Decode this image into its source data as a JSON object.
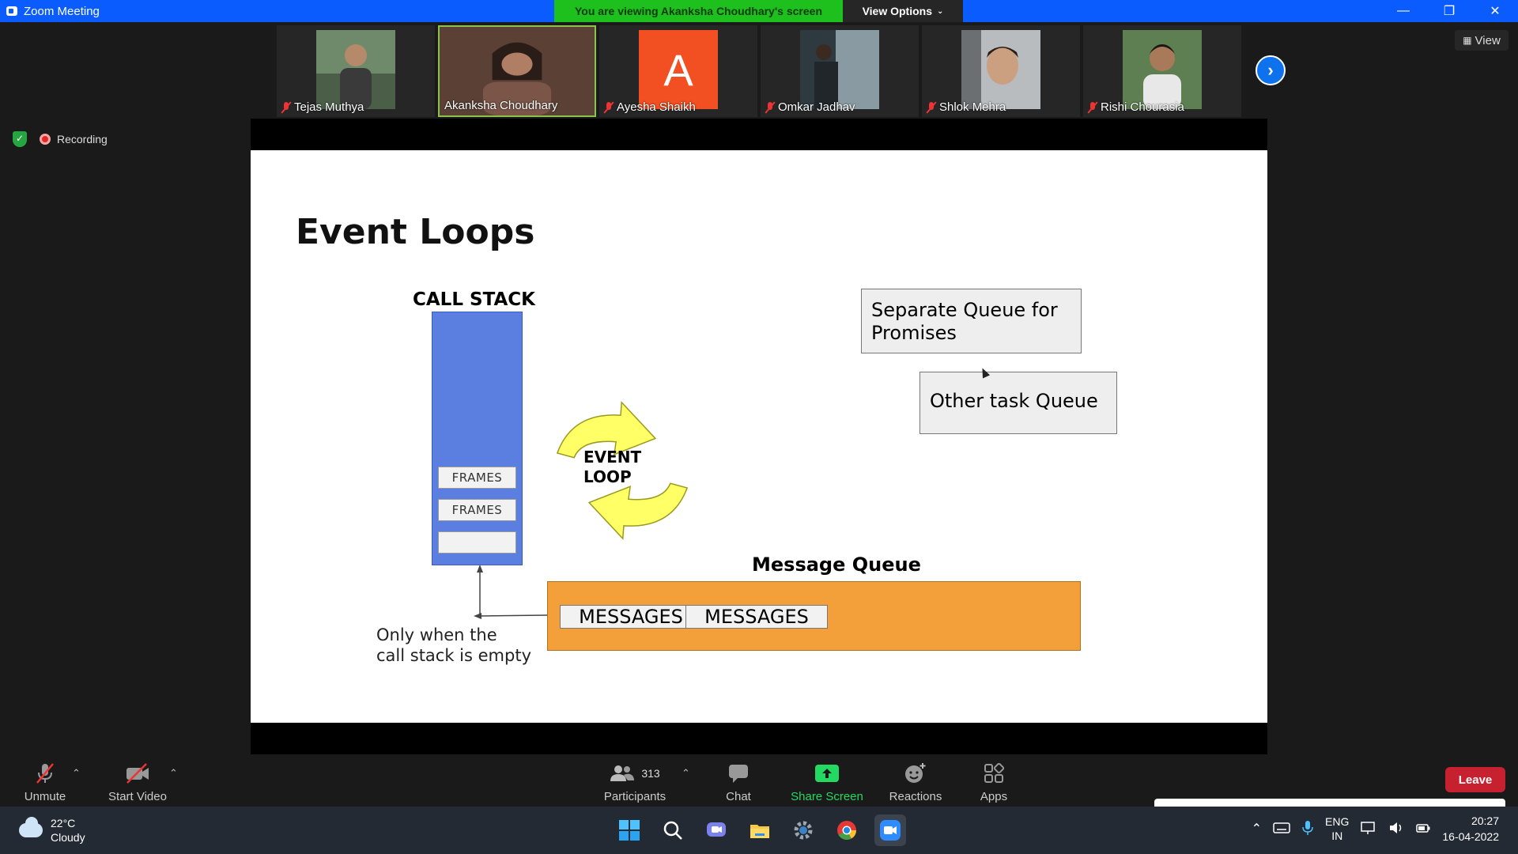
{
  "window": {
    "title": "Zoom Meeting",
    "banner": "You are viewing Akanksha Choudhary's screen",
    "view_options": "View Options"
  },
  "participants_strip": [
    {
      "name": "Tejas Muthya",
      "muted": true,
      "avatar_color": "#5d7a5a"
    },
    {
      "name": "Akanksha Choudhary",
      "muted": false,
      "avatar_color": "#6b4a3e"
    },
    {
      "name": "Ayesha Shaikh",
      "muted": true,
      "initial": "A",
      "avatar_color": "#f25022"
    },
    {
      "name": "Omkar Jadhav",
      "muted": true,
      "avatar_color": "#3b4a52"
    },
    {
      "name": "Shlok Mehra",
      "muted": true,
      "avatar_color": "#8a8f93"
    },
    {
      "name": "Rishi Chourasia",
      "muted": true,
      "avatar_color": "#4f7346"
    }
  ],
  "view_button": "View",
  "status": {
    "recording": "Recording"
  },
  "slide": {
    "title": "Event Loops",
    "call_stack_label": "CALL STACK",
    "frames": [
      "FRAMES",
      "FRAMES",
      ""
    ],
    "event_loop_label_line1": "EVENT",
    "event_loop_label_line2": "LOOP",
    "message_queue_label": "Message Queue",
    "messages": [
      "MESSAGES",
      "MESSAGES"
    ],
    "note": "Only when the\ncall stack is empty",
    "promise_queue": "Separate Queue for Promises",
    "task_queue": "Other task Queue",
    "colors": {
      "call_stack": "#5b7fe0",
      "message_queue": "#f4a03a",
      "event_loop_arrows": "#ffff66"
    }
  },
  "toolbar": {
    "unmute": "Unmute",
    "start_video": "Start Video",
    "participants": "Participants",
    "participant_count": "313",
    "chat": "Chat",
    "share_screen": "Share Screen",
    "reactions": "Reactions",
    "apps": "Apps",
    "leave": "Leave"
  },
  "taskbar": {
    "temperature": "22°C",
    "weather": "Cloudy",
    "language_line1": "ENG",
    "language_line2": "IN",
    "time": "20:27",
    "date": "16-04-2022"
  }
}
